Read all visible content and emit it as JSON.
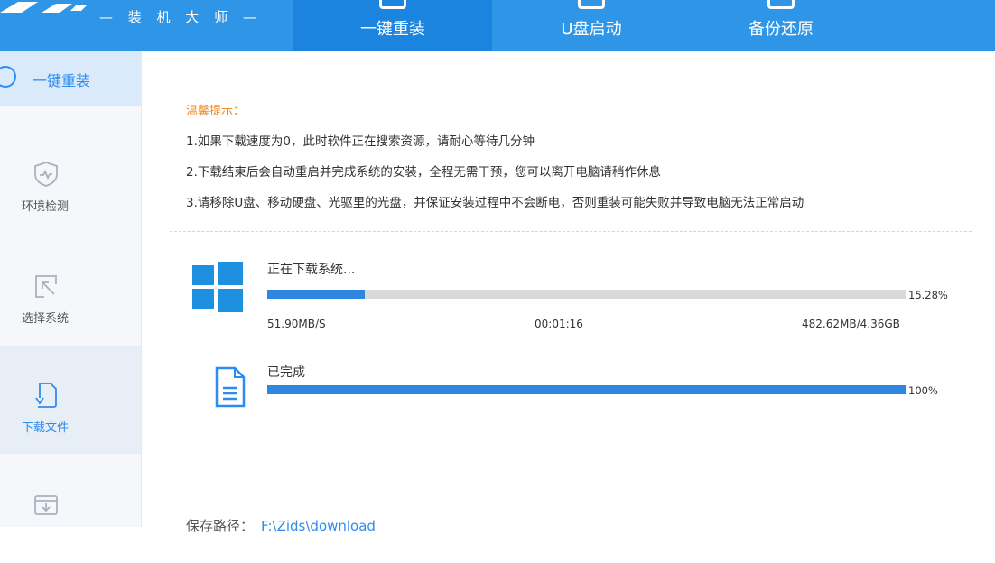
{
  "header": {
    "logo_text": "— 装 机 大 师 —",
    "tabs": [
      {
        "label": "一键重装",
        "active": true
      },
      {
        "label": "U盘启动",
        "active": false
      },
      {
        "label": "备份还原",
        "active": false
      }
    ]
  },
  "sidebar": {
    "top": {
      "label": "一键重装",
      "icon": "reinstall-icon"
    },
    "items": [
      {
        "label": "环境检测",
        "icon": "shield-check-icon"
      },
      {
        "label": "选择系统",
        "icon": "cursor-select-icon"
      },
      {
        "label": "下载文件",
        "icon": "file-download-icon",
        "active": true
      },
      {
        "label": "",
        "icon": "install-box-icon"
      }
    ]
  },
  "tips": {
    "title": "温馨提示：",
    "lines": [
      "1.如果下载速度为0，此时软件正在搜索资源，请耐心等待几分钟",
      "2.下载结束后会自动重启并完成系统的安装，全程无需干预，您可以离开电脑请稍作休息",
      "3.请移除U盘、移动硬盘、光驱里的光盘，并保证安装过程中不会断电，否则重装可能失败并导致电脑无法正常启动"
    ]
  },
  "downloads": [
    {
      "title": "正在下载系统...",
      "progress": 15.28,
      "percent_text": "15.28%",
      "speed": "51.90MB/S",
      "time": "00:01:16",
      "size": "482.62MB/4.36GB",
      "icon": "windows-logo-icon"
    },
    {
      "title": "已完成",
      "progress": 100,
      "percent_text": "100%",
      "icon": "document-icon"
    }
  ],
  "save_path": {
    "label": "保存路径：",
    "value": "F:\\Zids\\download"
  },
  "colors": {
    "header": "#2f95e6",
    "active_tab": "#1b84de",
    "accent": "#2d8cf0",
    "tips_title": "#f08a24",
    "progress_fill": "#2f86e0"
  }
}
